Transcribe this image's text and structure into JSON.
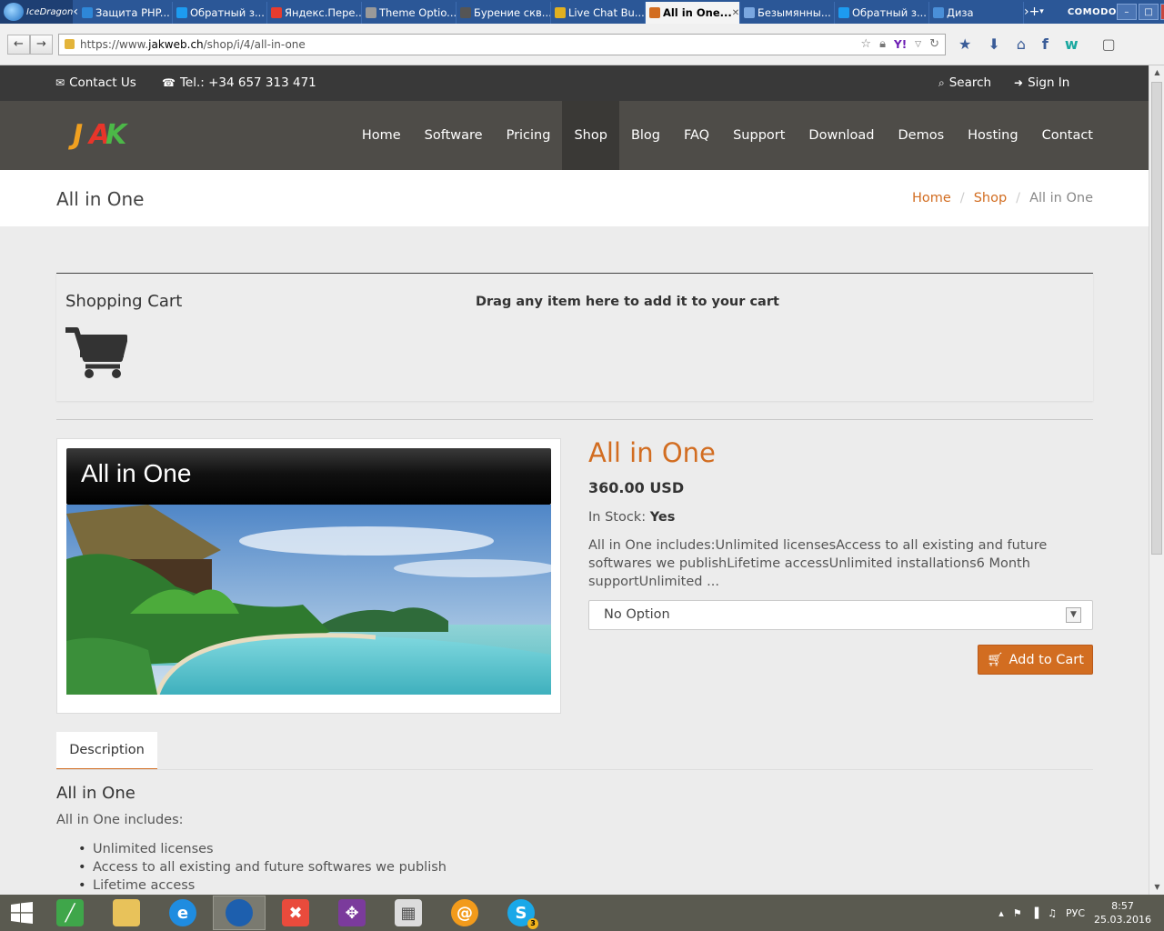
{
  "browser": {
    "logo_label": "IceDragon",
    "tabs": [
      {
        "label": "Защита PHP...",
        "color": "#2e87d8"
      },
      {
        "label": "Обратный з...",
        "color": "#1d9bf0"
      },
      {
        "label": "Яндекс.Пере...",
        "color": "#e63c2e"
      },
      {
        "label": "Theme Optio...",
        "color": "#999999"
      },
      {
        "label": "Бурение скв...",
        "color": "#555555"
      },
      {
        "label": "Live Chat Bu...",
        "color": "#e0b020"
      },
      {
        "label": "All in One...",
        "color": "#d26d21",
        "active": true
      },
      {
        "label": "Безымянны...",
        "color": "#7aa7e0"
      },
      {
        "label": "Обратный з...",
        "color": "#1d9bf0"
      },
      {
        "label": "Диза",
        "color": "#4a8fd8"
      }
    ],
    "brand": "COMODO",
    "url_prefix": "https://www.",
    "url_host": "jakweb.ch",
    "url_path": "/shop/i/4/all-in-one"
  },
  "topbar": {
    "contact": "Contact Us",
    "phone": "Tel.: +34 657 313 471",
    "search": "Search",
    "signin": "Sign In"
  },
  "nav": {
    "items": [
      "Home",
      "Software",
      "Pricing",
      "Shop",
      "Blog",
      "FAQ",
      "Support",
      "Download",
      "Demos",
      "Hosting",
      "Contact"
    ],
    "active": "Shop"
  },
  "page": {
    "title": "All in One",
    "breadcrumb": {
      "home": "Home",
      "shop": "Shop",
      "current": "All in One"
    }
  },
  "cart": {
    "title": "Shopping Cart",
    "drag_text": "Drag any item here to add it to your cart"
  },
  "product": {
    "image_heading": "All in One",
    "title": "All in One",
    "price": "360.00 USD",
    "stock_label": "In Stock:",
    "stock_value": "Yes",
    "description": "All in One includes:Unlimited licensesAccess to all existing and future softwares we publishLifetime accessUnlimited installations6 Month supportUnlimited ...",
    "option_selected": "No Option",
    "add_to_cart": "Add to Cart"
  },
  "tabs": {
    "description_tab": "Description"
  },
  "description": {
    "title": "All in One",
    "intro": "All in One includes:",
    "items": [
      "Unlimited licenses",
      "Access to all existing and future softwares we publish",
      "Lifetime access"
    ]
  },
  "taskbar": {
    "lang": "РУС",
    "time": "8:57",
    "date": "25.03.2016",
    "skype_badge": "3"
  },
  "colors": {
    "accent": "#d26d21",
    "header": "#4e4c48",
    "topstrip": "#393939"
  }
}
